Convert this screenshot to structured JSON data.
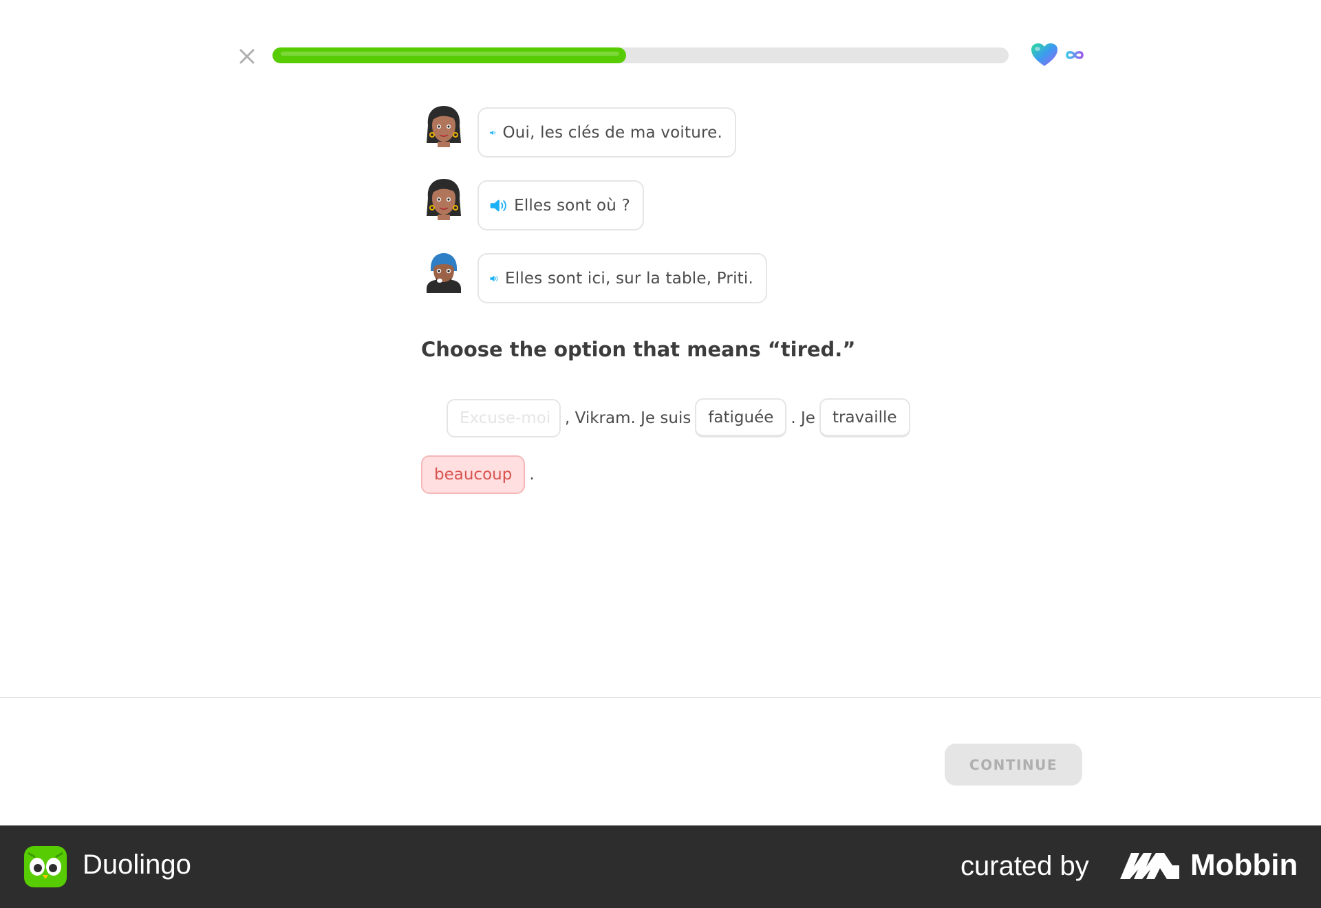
{
  "header": {
    "progress_percent": 48,
    "hearts": "∞"
  },
  "dialogue": [
    {
      "speaker": "woman",
      "text": "Oui, les clés de ma voiture."
    },
    {
      "speaker": "woman",
      "text": "Elles sont où ?"
    },
    {
      "speaker": "man",
      "text": "Elles sont ici, sur la table, Priti."
    }
  ],
  "prompt": "Choose the option that means “tired.”",
  "sentence": {
    "blank_placeholder": "Excuse-moi",
    "text1": ", Vikram. Je suis",
    "option1": "fatiguée",
    "text2": ". Je",
    "option2": "travaille",
    "option3": "beaucoup",
    "text3": "."
  },
  "footer": {
    "continue_label": "CONTINUE"
  },
  "brand": {
    "app_name": "Duolingo",
    "curated_by": "curated by",
    "curator": "Mobbin"
  },
  "colors": {
    "progress": "#58cc02",
    "speaker": "#1cb0f6",
    "wrong_bg": "#ffdfe0",
    "wrong_text": "#d9534f"
  }
}
